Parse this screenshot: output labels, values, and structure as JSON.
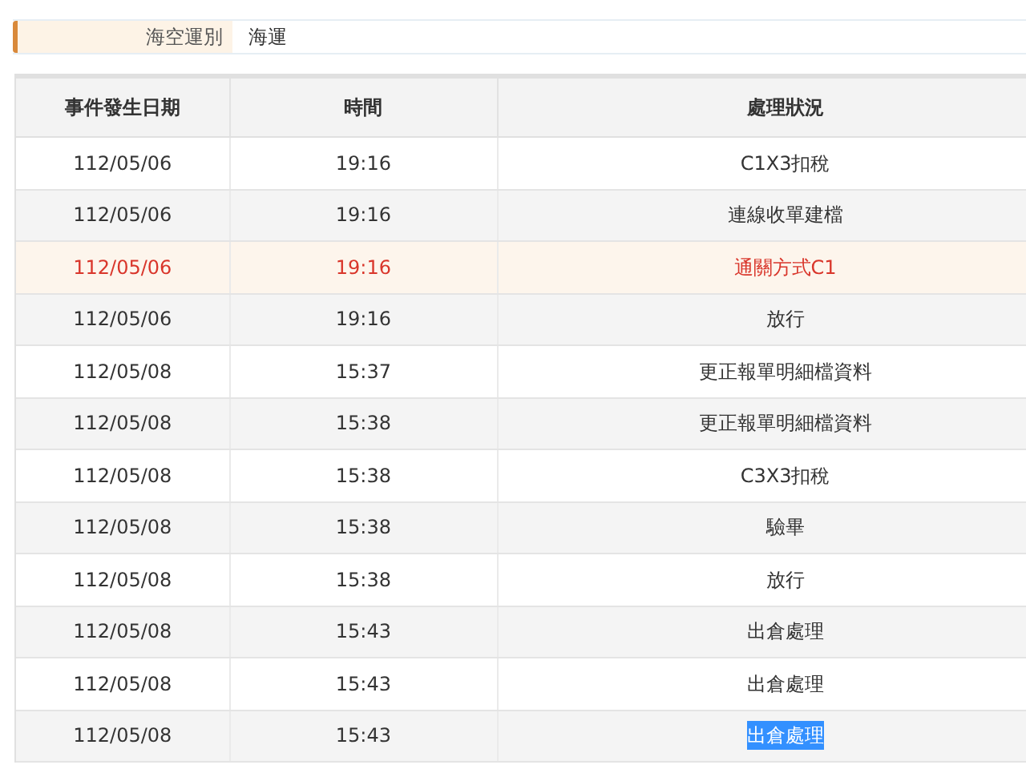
{
  "field": {
    "label": "海空運別",
    "value": "海運"
  },
  "table": {
    "columns": [
      "事件發生日期",
      "時間",
      "處理狀況"
    ],
    "rows": [
      {
        "cells": [
          "112/05/06",
          "19:16",
          "C1X3扣稅"
        ],
        "highlighted": false,
        "text_selected": false
      },
      {
        "cells": [
          "112/05/06",
          "19:16",
          "連線收單建檔"
        ],
        "highlighted": false,
        "text_selected": false
      },
      {
        "cells": [
          "112/05/06",
          "19:16",
          "通關方式C1"
        ],
        "highlighted": true,
        "text_selected": false
      },
      {
        "cells": [
          "112/05/06",
          "19:16",
          "放行"
        ],
        "highlighted": false,
        "text_selected": false
      },
      {
        "cells": [
          "112/05/08",
          "15:37",
          "更正報單明細檔資料"
        ],
        "highlighted": false,
        "text_selected": false
      },
      {
        "cells": [
          "112/05/08",
          "15:38",
          "更正報單明細檔資料"
        ],
        "highlighted": false,
        "text_selected": false
      },
      {
        "cells": [
          "112/05/08",
          "15:38",
          "C3X3扣稅"
        ],
        "highlighted": false,
        "text_selected": false
      },
      {
        "cells": [
          "112/05/08",
          "15:38",
          "驗畢"
        ],
        "highlighted": false,
        "text_selected": false
      },
      {
        "cells": [
          "112/05/08",
          "15:38",
          "放行"
        ],
        "highlighted": false,
        "text_selected": false
      },
      {
        "cells": [
          "112/05/08",
          "15:43",
          "出倉處理"
        ],
        "highlighted": false,
        "text_selected": false
      },
      {
        "cells": [
          "112/05/08",
          "15:43",
          "出倉處理"
        ],
        "highlighted": false,
        "text_selected": false
      },
      {
        "cells": [
          "112/05/08",
          "15:43",
          "出倉處理"
        ],
        "highlighted": false,
        "text_selected": true
      }
    ]
  }
}
